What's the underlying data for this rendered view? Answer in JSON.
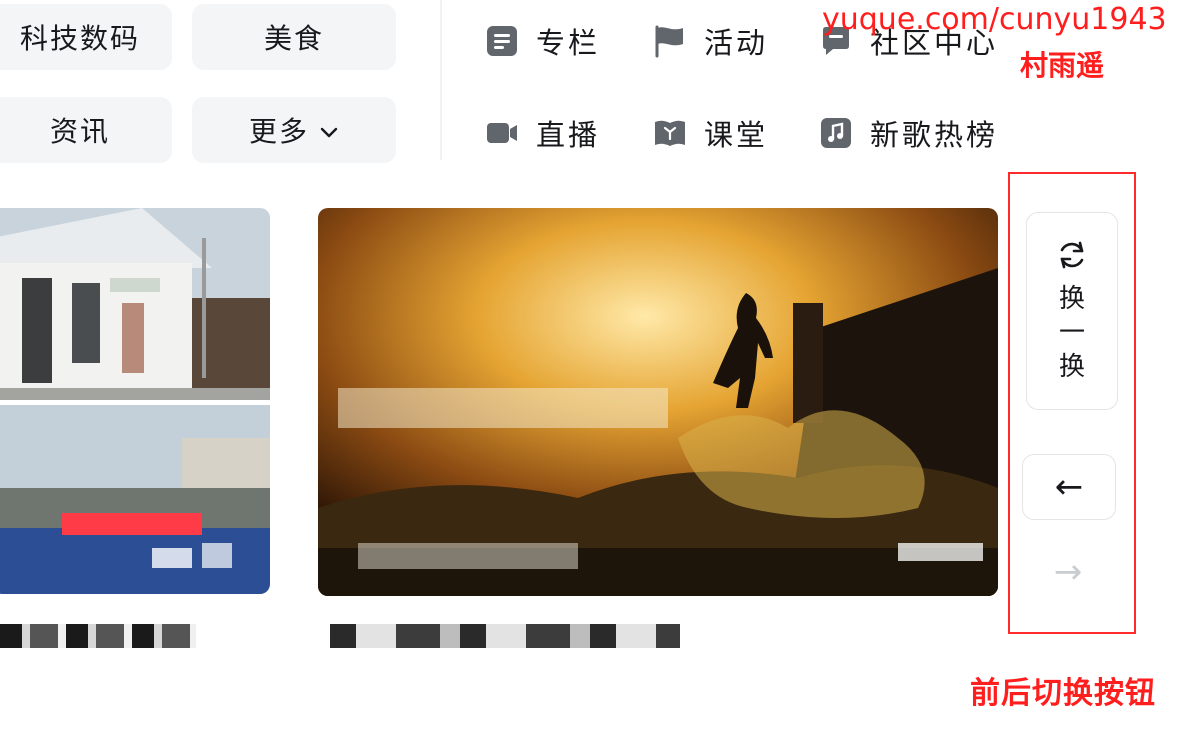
{
  "categories": {
    "tech": "科技数码",
    "food": "美食",
    "news": "资讯",
    "more": "更多"
  },
  "nav_links": {
    "column": "专栏",
    "activity": "活动",
    "community": "社区中心",
    "live": "直播",
    "classroom": "课堂",
    "new_songs": "新歌热榜"
  },
  "watermark": {
    "url": "yuque.com/cunyu1943",
    "name": "村雨遥"
  },
  "side_controls": {
    "refresh_label": "换\n一\n换",
    "prev_arrow": "←",
    "next_arrow": "→"
  },
  "annotation": {
    "caption": "前后切换按钮",
    "color": "#ff1e1e"
  },
  "icons": {
    "more": "chevron-down-icon",
    "column": "document-icon",
    "activity": "flag-icon",
    "community": "chat-icon",
    "live": "video-camera-icon",
    "classroom": "book-icon",
    "new_songs": "music-note-icon",
    "refresh": "refresh-icon",
    "prev": "arrow-left-icon",
    "next": "arrow-right-icon"
  }
}
